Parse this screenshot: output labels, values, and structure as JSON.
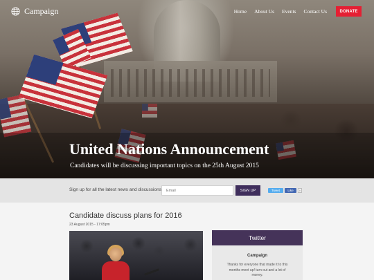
{
  "nav": {
    "brand": "Campaign",
    "links": [
      "Home",
      "About Us",
      "Events",
      "Contact Us"
    ],
    "donate_label": "DONATE"
  },
  "hero": {
    "title": "United Nations Announcement",
    "subtitle": "Candidates will be discussing important topics on the 25th August 2015"
  },
  "signup": {
    "text": "Sign up for all the latest news and discussions:",
    "email_placeholder": "Email",
    "button_label": "SIGN UP",
    "tweet_label": "Tweet",
    "like_label": "Like",
    "like_count": "0"
  },
  "post": {
    "title": "Candidate discuss plans for 2016",
    "date": "23 August 2015 - 17:05pm"
  },
  "twitter": {
    "heading": "Twitter",
    "user": "Campaign",
    "text": "Thanks for everyone that made it to this months meet up! turn out and a lot of money."
  },
  "colors": {
    "accent": "#3f2e5c",
    "donate": "#e51f33",
    "tweet": "#55acee",
    "like": "#4267b2"
  }
}
